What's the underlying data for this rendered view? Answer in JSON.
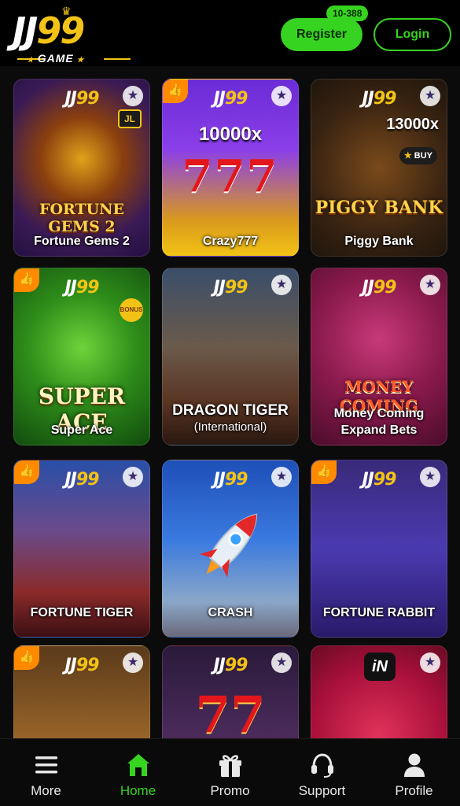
{
  "header": {
    "logo": {
      "text_jj": "JJ",
      "text_99": "99",
      "sub": "GAME"
    },
    "register_label": "Register",
    "register_badge": "10-388",
    "login_label": "Login"
  },
  "colors": {
    "accent_green": "#37d321",
    "brand_gold": "#f2c316"
  },
  "brand": {
    "jj": "JJ",
    "nn": "99"
  },
  "games": [
    {
      "name": "Fortune Gems 2",
      "art_title": "FORTUNE GEMS 2",
      "extra": "JL",
      "hot": false
    },
    {
      "name": "Crazy777",
      "multiplier": "10000x",
      "hot": true
    },
    {
      "name": "Piggy Bank",
      "art_title": "PIGGY BANK",
      "multiplier": "13000x",
      "buy": "BUY",
      "hot": false
    },
    {
      "name": "Super Ace",
      "art_title": "SUPER ACE",
      "bonus": "BONUS",
      "hot": true
    },
    {
      "name_line1": "DRAGON TIGER",
      "name_line2": "(International)",
      "hot": false
    },
    {
      "name_line1": "Money Coming",
      "name_line2": "Expand Bets",
      "art_title": "MONEY COMING",
      "hot": false
    },
    {
      "name": "FORTUNE TIGER",
      "hot": true
    },
    {
      "name": "CRASH",
      "hot": false
    },
    {
      "name": "FORTUNE RABBIT",
      "hot": true
    },
    {
      "hot": true
    },
    {
      "hot": false
    },
    {
      "provider": "iN",
      "hot": false
    }
  ],
  "bottom_nav": [
    {
      "label": "More",
      "icon": "menu-icon"
    },
    {
      "label": "Home",
      "icon": "home-icon",
      "active": true
    },
    {
      "label": "Promo",
      "icon": "gift-icon"
    },
    {
      "label": "Support",
      "icon": "headset-icon"
    },
    {
      "label": "Profile",
      "icon": "profile-icon"
    }
  ]
}
